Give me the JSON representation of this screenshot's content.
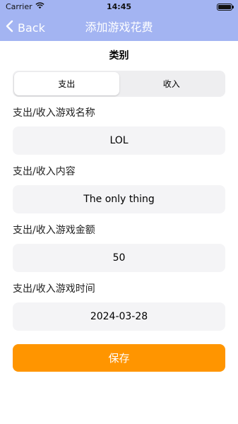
{
  "status_bar": {
    "carrier": "Carrier",
    "time": "14:45"
  },
  "nav": {
    "back_label": "Back",
    "title": "添加游戏花费"
  },
  "category": {
    "title": "类别",
    "segments": [
      "支出",
      "收入"
    ],
    "selected": "支出"
  },
  "fields": [
    {
      "label": "支出/收入游戏名称",
      "value": "LOL"
    },
    {
      "label": "支出/收入内容",
      "value": "The only thing"
    },
    {
      "label": "支出/收入游戏金额",
      "value": "50"
    },
    {
      "label": "支出/收入游戏时间",
      "value": "2024-03-28"
    }
  ],
  "save_label": "保存",
  "colors": {
    "nav_background": "#a3b4f2",
    "save_button": "#ff9500",
    "field_background": "#f4f4f6"
  }
}
